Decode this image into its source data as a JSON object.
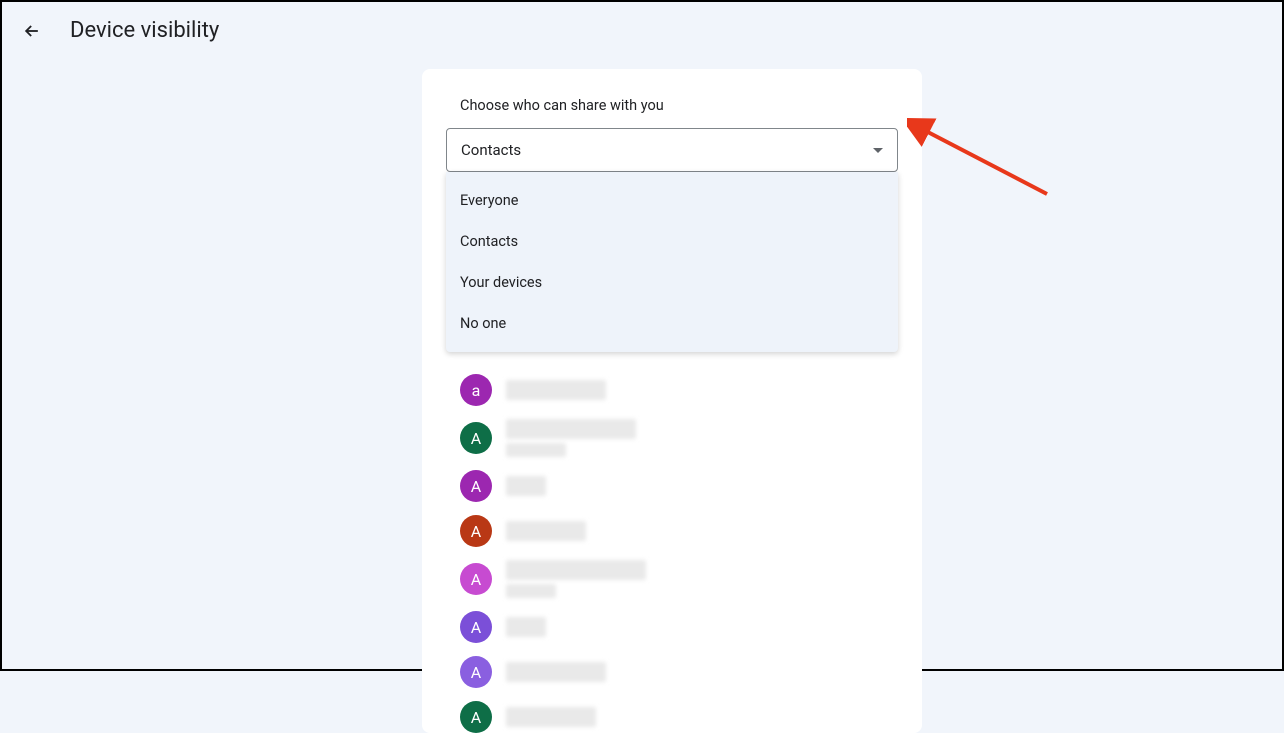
{
  "header": {
    "title": "Device visibility"
  },
  "panel": {
    "label": "Choose who can share with you",
    "selected": "Contacts",
    "options": [
      "Everyone",
      "Contacts",
      "Your devices",
      "No one"
    ]
  },
  "contacts": [
    {
      "initial": "a",
      "color": "#9c27b0",
      "nameWidth": 100
    },
    {
      "initial": "A",
      "color": "#0e6e47",
      "nameWidth": 130,
      "twoLine": true,
      "secondWidth": 60
    },
    {
      "initial": "A",
      "color": "#9c27b0",
      "nameWidth": 40
    },
    {
      "initial": "A",
      "color": "#b93815",
      "nameWidth": 80
    },
    {
      "initial": "A",
      "color": "#c74bd1",
      "nameWidth": 140,
      "twoLine": true,
      "secondWidth": 50
    },
    {
      "initial": "A",
      "color": "#7b4fd8",
      "nameWidth": 40
    },
    {
      "initial": "A",
      "color": "#8a5fe0",
      "nameWidth": 100
    },
    {
      "initial": "A",
      "color": "#0e6e47",
      "nameWidth": 90
    }
  ]
}
